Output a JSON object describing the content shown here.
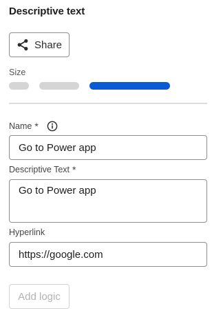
{
  "panel": {
    "title": "Descriptive text"
  },
  "share": {
    "label": "Share",
    "icon": "share-icon"
  },
  "size": {
    "label": "Size",
    "options": [
      "small",
      "medium",
      "large"
    ],
    "selected": "large",
    "accent_color": "#0a5bd3"
  },
  "fields": {
    "name": {
      "label": "Name",
      "required_mark": "*",
      "value": "Go to Power app"
    },
    "descriptive_text": {
      "label": "Descriptive Text",
      "required_mark": "*",
      "value": "Go to Power app"
    },
    "hyperlink": {
      "label": "Hyperlink",
      "value": "https://google.com"
    }
  },
  "actions": {
    "add_logic_label": "Add logic",
    "add_logic_enabled": false
  }
}
